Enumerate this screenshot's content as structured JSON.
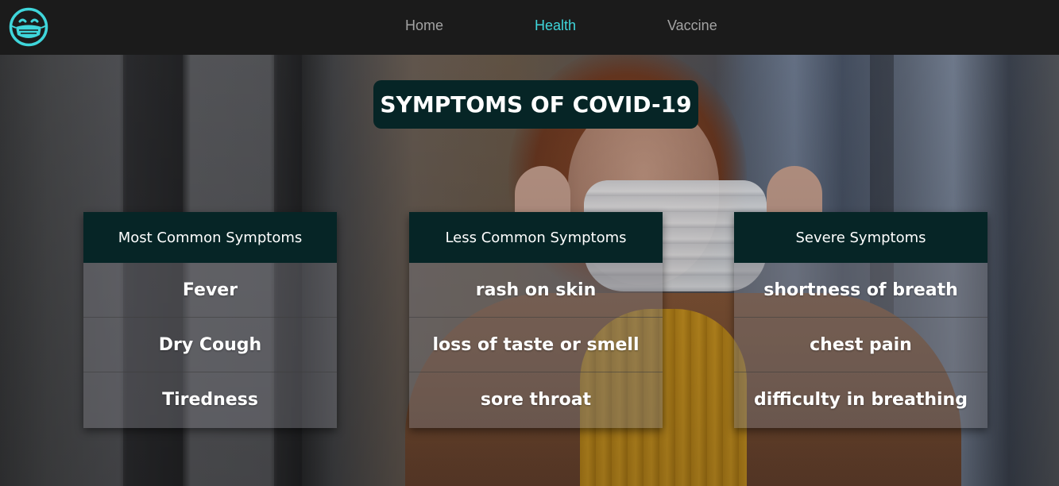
{
  "colors": {
    "navbar_bg": "#1b1b1b",
    "nav_link": "#a3a3a3",
    "nav_active": "#3fd6db",
    "logo": "#3fd6db",
    "dark_teal": "#062526",
    "text": "#ffffff"
  },
  "navbar": {
    "logo_icon": "smiling-face-with-mask-icon",
    "links": [
      {
        "label": "Home",
        "active": false
      },
      {
        "label": "Health",
        "active": true
      },
      {
        "label": "Vaccine",
        "active": false
      }
    ]
  },
  "hero": {
    "background": "photo-woman-putting-on-face-mask"
  },
  "main": {
    "title": "SYMPTOMS OF COVID-19",
    "cards": [
      {
        "header": "Most Common Symptoms",
        "items": [
          "Fever",
          "Dry Cough",
          "Tiredness"
        ]
      },
      {
        "header": "Less Common Symptoms",
        "items": [
          "rash on skin",
          "loss of taste or smell",
          "sore throat"
        ]
      },
      {
        "header": "Severe Symptoms",
        "items": [
          "shortness of breath",
          "chest pain",
          "difficulty in breathing"
        ]
      }
    ]
  }
}
